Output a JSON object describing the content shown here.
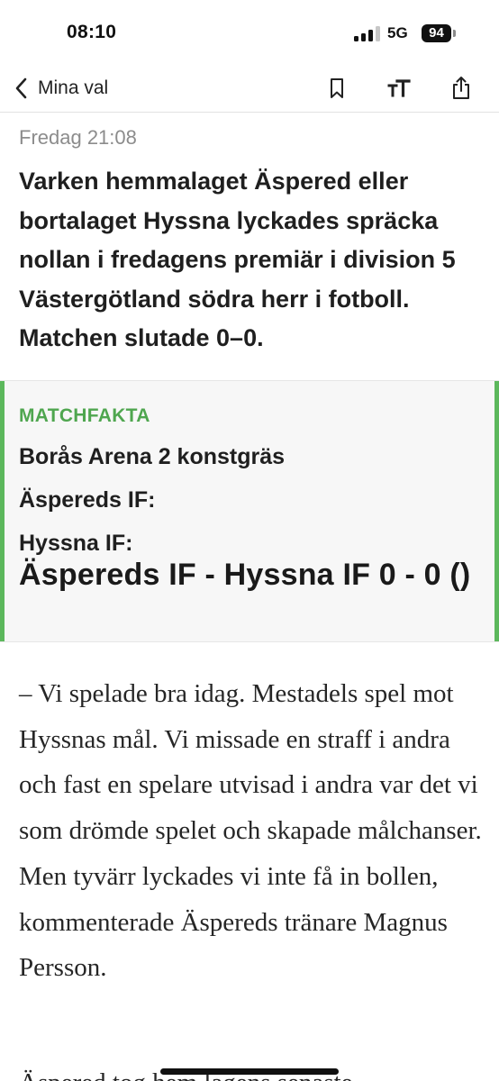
{
  "status_bar": {
    "time": "08:10",
    "network": "5G",
    "battery": "94",
    "signal_bars_active": 3,
    "signal_bars_total": 4
  },
  "nav": {
    "back_label": "Mina val",
    "icons": [
      "chevron-left-icon",
      "bookmark-icon",
      "text-size-icon",
      "share-icon"
    ]
  },
  "article": {
    "timestamp": "Fredag 21:08",
    "lead": "Varken hemmalaget Äspered eller bortalaget Hyssna lyckades spräcka nollan i fredagens premiär i division 5 Västergötland södra herr i fotboll. Matchen slutade 0–0.",
    "matchfakta": {
      "heading": "MATCHFAKTA",
      "venue": "Borås Arena 2 konstgräs",
      "home_team": "Äspereds IF:",
      "away_team": "Hyssna IF:",
      "result": "Äspereds IF - Hyssna IF 0 - 0 ()"
    },
    "paragraph_1": "– Vi spelade bra idag. Mestadels spel mot Hyssnas mål. Vi missade en straff i andra och fast en spelare utvisad i andra var det vi som drömde spelet och skapade målchanser. Men tyvärr lyckades vi inte få in bollen, kommenterade Äspereds tränare Magnus Persson.",
    "paragraph_2_partial": "Äspered tog hem lagens senaste"
  },
  "colors": {
    "accent_green": "#5cb85c",
    "heading_green": "#4fa64f",
    "timestamp_gray": "#8c8c8c"
  }
}
